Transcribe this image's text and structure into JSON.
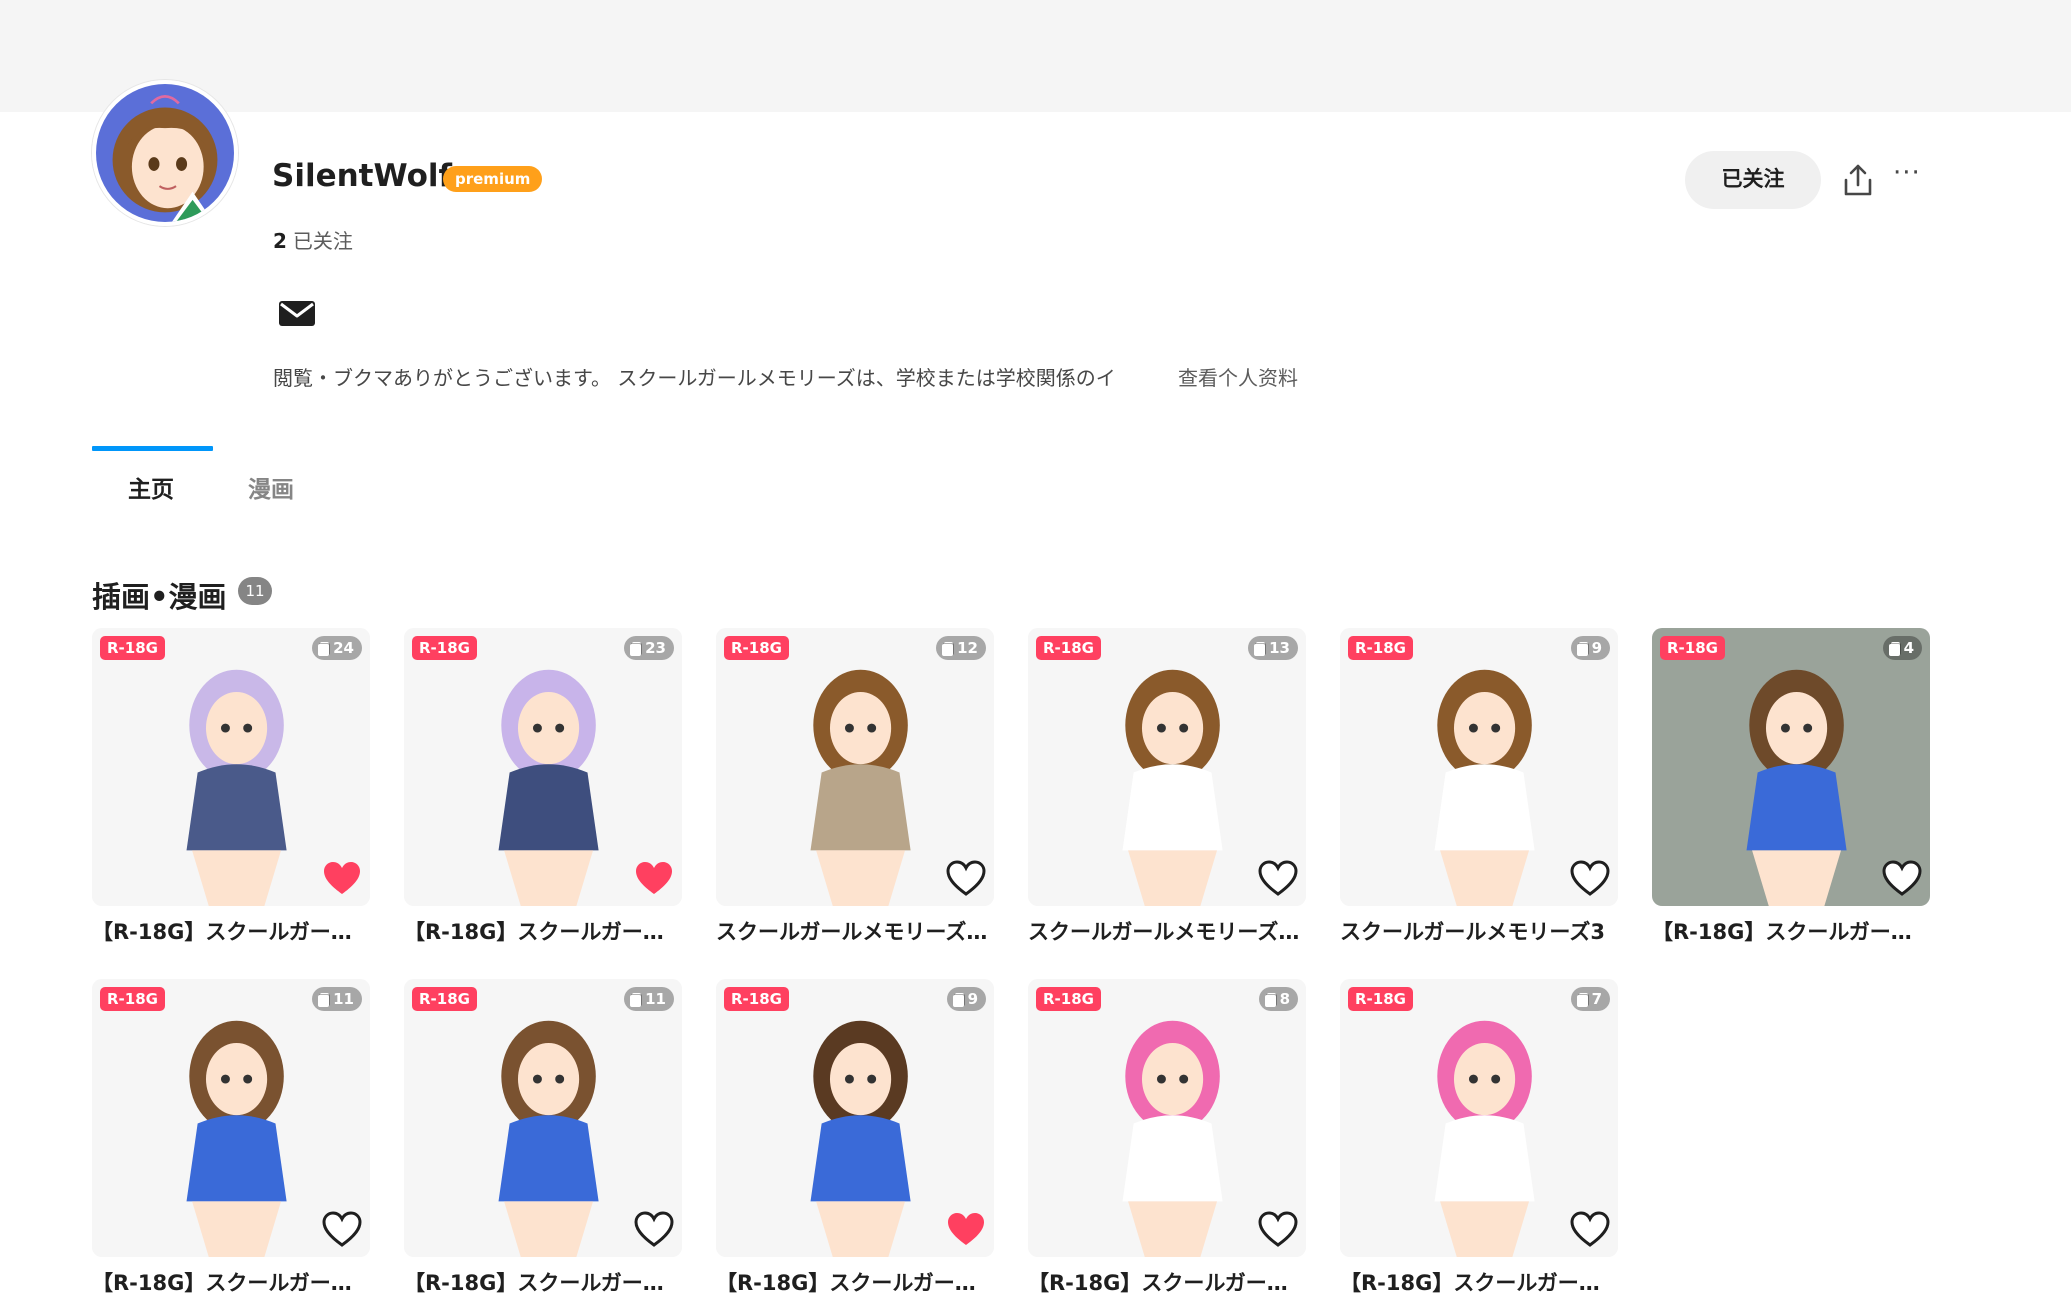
{
  "profile": {
    "username": "SilentWolf",
    "premium_label": "premium",
    "following_count": "2",
    "following_label": "已关注",
    "bio": "閲覧・ブクマありがとうございます。 スクールガールメモリーズは、学校または学校関係のイ",
    "view_profile_label": "查看个人资料",
    "follow_button_label": "已关注",
    "more_label": "···"
  },
  "tabs": [
    {
      "label": "主页",
      "active": true
    },
    {
      "label": "漫画",
      "active": false
    }
  ],
  "section": {
    "title": "插画•漫画",
    "count": "11"
  },
  "colors": {
    "accent": "#0096fa",
    "r18g_badge": "#ff4060",
    "premium": "#ffa01a",
    "liked_heart": "#ff4060"
  },
  "works": [
    {
      "title": "【R-18G】スクールガール…",
      "badge": "R-18G",
      "pages": "24",
      "liked": true
    },
    {
      "title": "【R-18G】スクールガール…",
      "badge": "R-18G",
      "pages": "23",
      "liked": true
    },
    {
      "title": "スクールガールメモリーズ…",
      "badge": "R-18G",
      "pages": "12",
      "liked": false
    },
    {
      "title": "スクールガールメモリーズ…",
      "badge": "R-18G",
      "pages": "13",
      "liked": false
    },
    {
      "title": "スクールガールメモリーズ3",
      "badge": "R-18G",
      "pages": "9",
      "liked": false
    },
    {
      "title": "【R-18G】スクールガール…",
      "badge": "R-18G",
      "pages": "4",
      "liked": false
    },
    {
      "title": "【R-18G】スクールガール…",
      "badge": "R-18G",
      "pages": "11",
      "liked": false
    },
    {
      "title": "【R-18G】スクールガール…",
      "badge": "R-18G",
      "pages": "11",
      "liked": false
    },
    {
      "title": "【R-18G】スクールガール…",
      "badge": "R-18G",
      "pages": "9",
      "liked": true
    },
    {
      "title": "【R-18G】スクールガール…",
      "badge": "R-18G",
      "pages": "8",
      "liked": false
    },
    {
      "title": "【R-18G】スクールガール…",
      "badge": "R-18G",
      "pages": "7",
      "liked": false
    }
  ]
}
